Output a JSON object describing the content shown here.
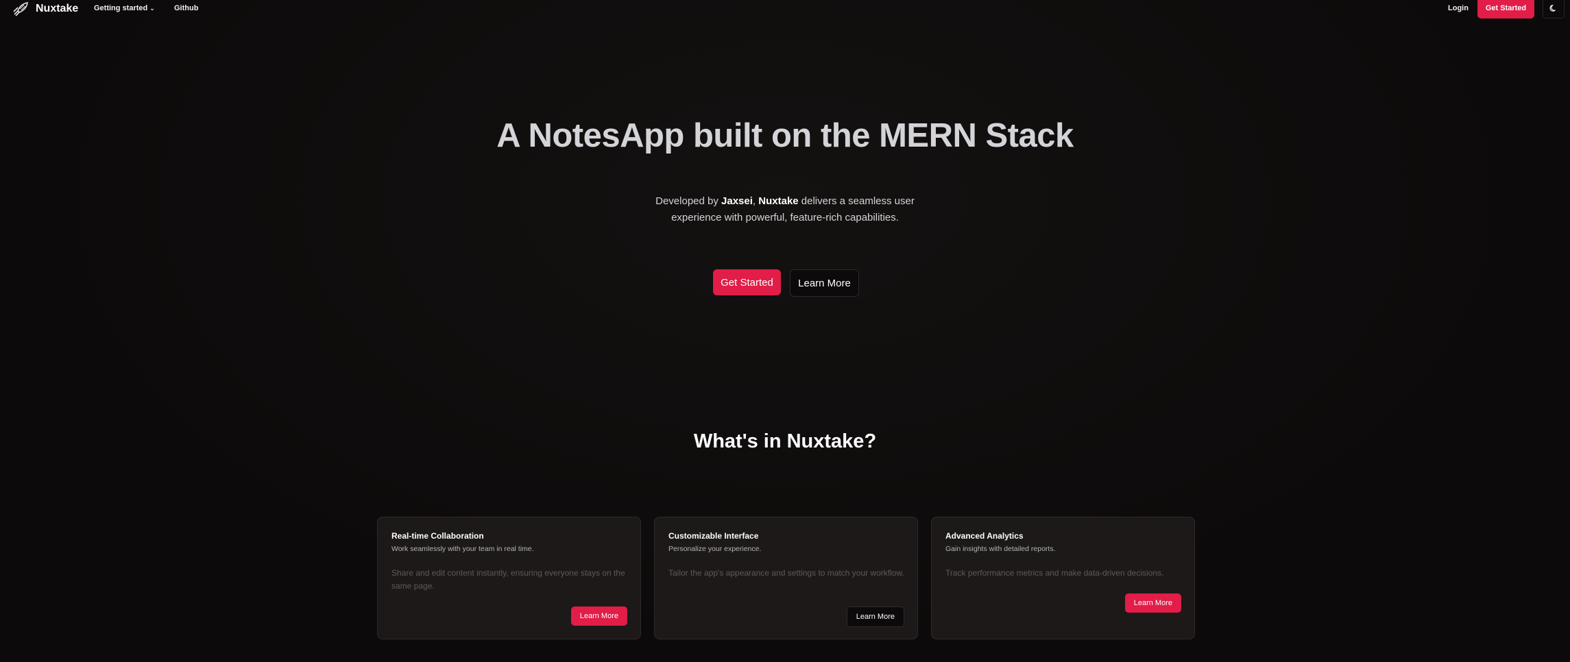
{
  "nav": {
    "brand": "Nuxtake",
    "links": [
      {
        "label": "Getting started",
        "has_dropdown": true
      },
      {
        "label": "Github",
        "has_dropdown": false
      }
    ],
    "login": "Login",
    "cta": "Get Started",
    "theme_icon": "moon-icon"
  },
  "hero": {
    "title": "A NotesApp built on the MERN Stack",
    "desc_pre": "Developed by ",
    "desc_author": "Jaxsei",
    "desc_sep": ", ",
    "desc_brand": "Nuxtake",
    "desc_post": " delivers a seamless user experience with powerful, feature-rich capabilities.",
    "primary_btn": "Get Started",
    "secondary_btn": "Learn More"
  },
  "features": {
    "title": "What's in Nuxtake?",
    "cards": [
      {
        "title": "Real-time Collaboration",
        "subtitle": "Work seamlessly with your team in real time.",
        "body": "Share and edit content instantly, ensuring everyone stays on the same page.",
        "button": "Learn More"
      },
      {
        "title": "Customizable Interface",
        "subtitle": "Personalize your experience.",
        "body": "Tailor the app's appearance and settings to match your workflow.",
        "button": "Learn More"
      },
      {
        "title": "Advanced Analytics",
        "subtitle": "Gain insights with detailed reports.",
        "body": "Track performance metrics and make data-driven decisions.",
        "button": "Learn More"
      }
    ]
  },
  "colors": {
    "accent": "#e11d48",
    "background": "#0c0a0a",
    "card": "#1c1918"
  }
}
